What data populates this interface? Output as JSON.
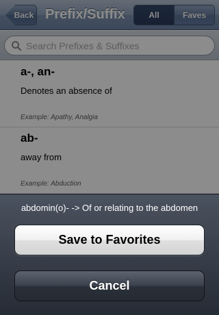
{
  "navbar": {
    "back_label": "Back",
    "title": "Prefix/Suffix",
    "segments": {
      "all": "All",
      "faves": "Faves"
    }
  },
  "search": {
    "placeholder": "Search Prefixes & Suffixes",
    "value": ""
  },
  "entries": [
    {
      "term": "a-, an-",
      "definition": "Denotes an absence of",
      "example": "Example: Apathy, Analgia"
    },
    {
      "term": "ab-",
      "definition": "away from",
      "example": "Example: Abduction"
    }
  ],
  "action_sheet": {
    "message": "abdomin(o)- -> Of or relating to the abdomen",
    "save_label": "Save to Favorites",
    "cancel_label": "Cancel"
  },
  "colors": {
    "navbar": "#7d92ae",
    "selected_segment": "#2a3b5b",
    "sheet_background": "#2f3540"
  }
}
